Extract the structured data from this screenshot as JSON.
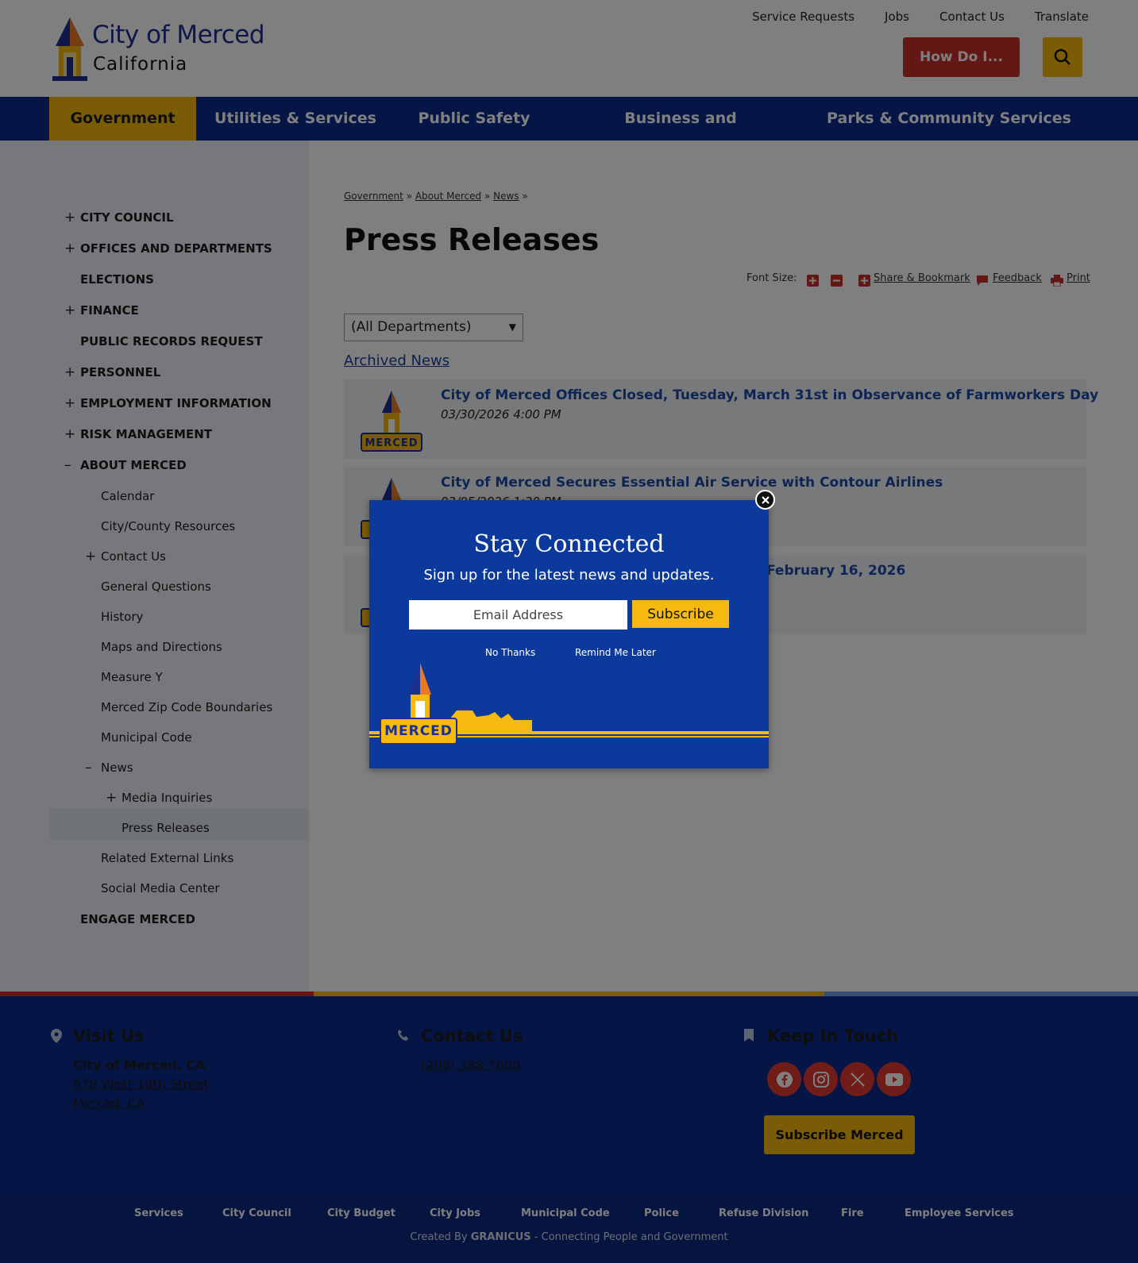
{
  "header": {
    "logo_city": "City of Merced",
    "logo_state": "California",
    "utility_links": [
      "Service Requests",
      "Jobs",
      "Contact Us",
      "Translate"
    ],
    "how_do_i": "How Do I..."
  },
  "nav": {
    "items": [
      "Government",
      "Utilities & Services",
      "Public Safety",
      "Business and Development",
      "Parks & Community Services"
    ]
  },
  "sidebar": {
    "items": [
      {
        "label": "CITY COUNCIL",
        "mark": "+"
      },
      {
        "label": "OFFICES AND DEPARTMENTS",
        "mark": "+"
      },
      {
        "label": "ELECTIONS",
        "mark": ""
      },
      {
        "label": "FINANCE",
        "mark": "+"
      },
      {
        "label": "PUBLIC RECORDS REQUEST",
        "mark": ""
      },
      {
        "label": "PERSONNEL",
        "mark": "+"
      },
      {
        "label": "EMPLOYMENT INFORMATION",
        "mark": "+"
      },
      {
        "label": "RISK MANAGEMENT",
        "mark": "+"
      },
      {
        "label": "ABOUT MERCED",
        "mark": "–"
      },
      {
        "label": "Calendar",
        "mark": ""
      },
      {
        "label": "City/County Resources",
        "mark": ""
      },
      {
        "label": "Contact Us",
        "mark": "+"
      },
      {
        "label": "General Questions",
        "mark": ""
      },
      {
        "label": "History",
        "mark": ""
      },
      {
        "label": "Maps and Directions",
        "mark": ""
      },
      {
        "label": "Measure Y",
        "mark": ""
      },
      {
        "label": "Merced Zip Code Boundaries",
        "mark": ""
      },
      {
        "label": "Municipal Code",
        "mark": ""
      },
      {
        "label": "News",
        "mark": "–"
      },
      {
        "label": "Media Inquiries",
        "mark": "+"
      },
      {
        "label": "Press Releases",
        "mark": ""
      },
      {
        "label": "Related External Links",
        "mark": ""
      },
      {
        "label": "Social Media Center",
        "mark": ""
      },
      {
        "label": "ENGAGE MERCED",
        "mark": ""
      }
    ]
  },
  "breadcrumb": [
    "Government",
    "About Merced",
    "News"
  ],
  "page_title": "Press Releases",
  "tools": {
    "font_size_label": "Font Size:",
    "share": "Share & Bookmark",
    "feedback": "Feedback",
    "print": "Print"
  },
  "department_select": "(All Departments)",
  "archived_news": "Archived News",
  "news": [
    {
      "title": "City of Merced Offices Closed, Tuesday, March 31st in Observance of Farmworkers Day",
      "date": "03/30/2026 4:00 PM"
    },
    {
      "title": "City of Merced Secures Essential Air Service with Contour Airlines",
      "date": "03/05/2026 1:30 PM"
    },
    {
      "title": "February 16, 2026",
      "date": ""
    }
  ],
  "logo_badge": "MERCED",
  "footer": {
    "visit_heading": "Visit Us",
    "visit_name": "City of Merced, CA",
    "visit_street": "678 West 18th Street",
    "visit_city": "Merced, CA",
    "contact_heading": "Contact Us",
    "contact_phone": "(209) 388-7000",
    "keep_heading": "Keep In Touch",
    "subscribe_label": "Subscribe Merced",
    "social": [
      "facebook-icon",
      "instagram-icon",
      "x-icon",
      "youtube-icon"
    ]
  },
  "footer_links": [
    "Services",
    "City Council",
    "City Budget",
    "City Jobs",
    "Municipal Code",
    "Police",
    "Refuse Division",
    "Fire",
    "Employee Services"
  ],
  "credit": {
    "prefix": "Created By ",
    "brand": "GRANICUS",
    "suffix": " - Connecting People and Government"
  },
  "modal": {
    "title": "Stay Connected",
    "subtitle": "Sign up for the latest news and updates.",
    "email_placeholder": "Email Address",
    "subscribe": "Subscribe",
    "no_thanks": "No Thanks",
    "remind_later": "Remind Me Later"
  },
  "colors": {
    "navy": "#0a2a8a",
    "gold": "#f5b90f",
    "red": "#c8312b",
    "link_blue": "#1d4ba8"
  }
}
